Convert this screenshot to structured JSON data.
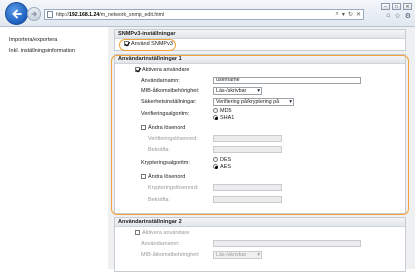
{
  "browser": {
    "url_prefix": "http://",
    "url_host": "192.168.1.24",
    "url_path": "/m_network_snmp_edit.html",
    "address_tools": [
      "⌕",
      "▾",
      "↻",
      "✕"
    ],
    "window_buttons": [
      "–",
      "□",
      "✕"
    ],
    "nav_icons": [
      "⌂",
      "☆",
      "⚙"
    ]
  },
  "leftnav": {
    "items": [
      "Importera/exportera",
      "Inkl. inställningsinformation"
    ]
  },
  "snmpv3": {
    "heading": "SNMPv3-inställningar",
    "enable_label": "Använd SNMPv3"
  },
  "user1": {
    "heading": "Användarinställningar 1",
    "activate_label": "Aktivera användare",
    "username_label": "Användarnamn:",
    "username_value": "username",
    "mib_label": "MIB-åtkomstbehörighet:",
    "mib_value": "Läs-/skrivbar",
    "security_label": "Säkerhetsinställningar:",
    "security_value": "Verifiering på/kryptering på",
    "auth_algo_label": "Verifieringsalgoritm:",
    "auth_options": [
      "MD5",
      "SHA1"
    ],
    "change_password_label": "Ändra lösenord",
    "auth_password_label": "Verifieringslösenord:",
    "confirm_label": "Bekräfta:",
    "enc_algo_label": "Krypteringsalgoritm:",
    "enc_options": [
      "DES",
      "AES"
    ],
    "change_password_label2": "Ändra lösenord",
    "enc_password_label": "Krypteringslösenord:",
    "confirm_label2": "Bekräfta:"
  },
  "user2": {
    "heading": "Användarinställningar 2",
    "activate_label": "Aktivera användare",
    "username_label": "Användarnamn:",
    "mib_label": "MIB-åtkomstbehörighet:",
    "mib_value": "Läs-/skrivbar"
  },
  "colors": {
    "highlight": "#f2a23a",
    "back_button": "#1c5fbf"
  }
}
